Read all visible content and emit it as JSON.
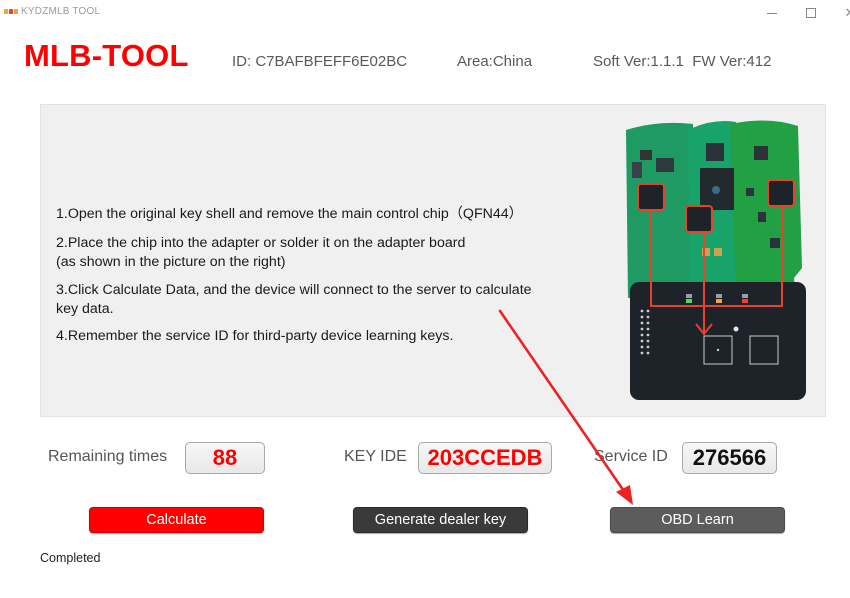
{
  "window": {
    "title": "KYDZMLB TOOL",
    "icon": "app-logo-icon",
    "controls": {
      "minimize": "minimize-icon",
      "maximize": "maximize-icon",
      "close": "close-icon",
      "close_glyph": "✕"
    }
  },
  "header": {
    "brand": "MLB-TOOL",
    "device_id": "ID: C7BAFBFEFF6E02BC",
    "area": "Area:China",
    "version": "Soft Ver:1.1.1  FW Ver:412"
  },
  "instructions": {
    "step1": "1.Open the original key shell and remove the main control chip（QFN44）",
    "step2": "2.Place the chip into the adapter or solder it on the adapter board\n(as shown in the picture on the right)",
    "step3": "3.Click Calculate Data, and the device will connect to the server to calculate\nkey data.",
    "step4": "4.Remember the service ID for third-party device learning keys."
  },
  "picture": {
    "description": "Key PCBs with highlighted QFN44 chips and adapter board",
    "highlight_color": "#e8412c",
    "board_color": "#1e2229",
    "pcb_color": "#1f9a62"
  },
  "fields": {
    "remaining_label": "Remaining times",
    "remaining_value": "88",
    "keyide_label": "KEY IDE",
    "keyide_value": "203CCEDB",
    "service_label": "Service ID",
    "service_value": "276566"
  },
  "buttons": {
    "calculate": "Calculate",
    "dealer_key": "Generate dealer key",
    "obd_learn": "OBD Learn"
  },
  "status": {
    "text": "Completed"
  },
  "annotation": {
    "arrow_color": "#ee2222",
    "target": "OBD Learn"
  },
  "colors": {
    "brand_red": "#ff0000",
    "panel_bg": "#f0f0f0",
    "dark_button": "#3a3a3a",
    "gray_button": "#5c5c5c"
  }
}
